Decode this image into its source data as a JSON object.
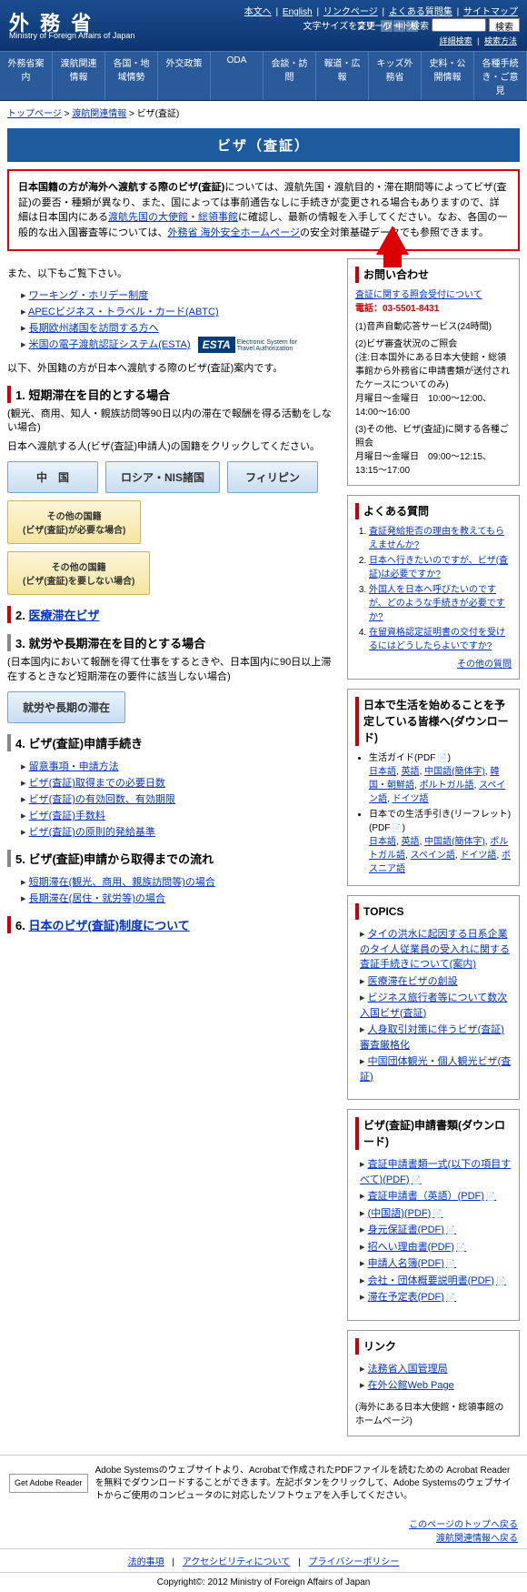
{
  "header": {
    "logo": "外 務 省",
    "logo_sub": "Ministry of Foreign Affairs of Japan",
    "top_links": [
      "本文へ",
      "English",
      "リンクページ",
      "よくある質問集",
      "サイトマップ"
    ],
    "font_label": "文字サイズを変更",
    "font_btns": [
      "小",
      "中",
      "大"
    ],
    "search_label": "フリーワード検索",
    "search_btn": "検索",
    "search_sub": [
      "詳細検索",
      "検索方法"
    ]
  },
  "nav": [
    "外務省案内",
    "渡航関連情報",
    "各国・地域情勢",
    "外交政策",
    "ODA",
    "会談・訪問",
    "報道・広報",
    "キッズ外務省",
    "史料・公開情報",
    "各種手続き・ご意見"
  ],
  "breadcrumb": {
    "items": [
      "トップページ",
      "渡航関連情報"
    ],
    "current": "ビザ(査証)"
  },
  "title": "ビザ（査証）",
  "notice": {
    "bold": "日本国籍の方が海外へ渡航する際のビザ(査証)",
    "text1": "については、渡航先国・渡航目的・滞在期間等によってビザ(査証)の要否・種類が異なり、また、国によっては事前通告なしに手続きが変更される場合もありますので、詳細は日本国内にある",
    "link1": "渡航先国の大使館・総領事館",
    "text2": "に確認し、最新の情報を入手してください。なお、各国の一般的な出入国審査等については、",
    "link2": "外務省 海外安全ホームページ",
    "text3": "の安全対策基礎データでも参照できます。"
  },
  "intro": "また、以下もご覧下さい。",
  "intro_links": [
    "ワーキング・ホリデー制度",
    "APECビジネス・トラベル・カード(ABTC)",
    "長期欧州諸国を訪問する方へ",
    "米国の電子渡航認証システム(ESTA)"
  ],
  "section_intro": "以下、外国籍の方が日本へ渡航する際のビザ(査証)案内です。",
  "sec1": {
    "h": "1. 短期滞在を目的とする場合",
    "sub": "(観光、商用、知人・親族訪問等90日以内の滞在で報酬を得る活動をしない場合)",
    "sub2": "日本へ渡航する人(ビザ(査証)申請人)の国籍をクリックしてください。",
    "btns": [
      "中　国",
      "ロシア・NIS諸国",
      "フィリピン"
    ],
    "yellow": [
      "その他の国籍\n(ビザ(査証)が必要な場合)",
      "その他の国籍\n(ビザ(査証)を要しない場合)"
    ]
  },
  "sec2": {
    "h": "2.",
    "link": "医療滞在ビザ"
  },
  "sec3": {
    "h": "3. 就労や長期滞在を目的とする場合",
    "sub": "(日本国内において報酬を得て仕事をするときや、日本国内に90日以上滞在するときなど短期滞在の要件に該当しない場合)",
    "btn": "就労や長期の滞在"
  },
  "sec4": {
    "h": "4. ビザ(査証)申請手続き",
    "links": [
      "留意事項・申請方法",
      "ビザ(査証)取得までの必要日数",
      "ビザ(査証)の有効回数、有効期限",
      "ビザ(査証)手数料",
      "ビザ(査証)の原則的発給基準"
    ]
  },
  "sec5": {
    "h": "5. ビザ(査証)申請から取得までの流れ",
    "links": [
      "短期滞在(観光、商用、親族訪問等)の場合",
      "長期滞在(居住・就労等)の場合"
    ]
  },
  "sec6": {
    "h": "6.",
    "link": "日本のビザ(査証)制度について"
  },
  "side": {
    "inquiry": {
      "h": "お問い合わせ",
      "link": "査証に関する照会受付について",
      "tel_label": "電話：",
      "tel": "03-5501-8431",
      "items": [
        "(1)音声自動応答サービス(24時間)",
        "(2)ビザ審査状況のご照会\n(注:日本国外にある日本大使館・総領事館から外務省に申請書類が送付されたケースについてのみ)\n月曜日～金曜日　10:00～12:00、14:00～16:00",
        "(3)その他、ビザ(査証)に関する各種ご照会\n月曜日～金曜日　09:00～12:15、13:15～17:00"
      ]
    },
    "faq": {
      "h": "よくある質問",
      "items": [
        "査証発給拒否の理由を教えてもらえませんか?",
        "日本へ行きたいのですが、ビザ(査証)は必要ですか?",
        "外国人を日本へ呼びたいのですが、どのような手続きが必要ですか?",
        "在留資格認定証明書の交付を受けるにはどうしたらよいですか?"
      ],
      "more": "その他の質問"
    },
    "dl": {
      "h": "日本で生活を始めることを予定している皆様へ(ダウンロード)",
      "g1": "生活ガイド(PDF",
      "g1_links": [
        "日本語",
        "英語",
        "中国語(簡体字)",
        "韓国・朝鮮語",
        "ポルトガル語",
        "スペイン語",
        "ドイツ語"
      ],
      "g2": "日本での生活手引き(リーフレット)(PDF",
      "g2_links": [
        "日本語",
        "英語",
        "中国語(簡体字)",
        "ポルトガル語",
        "スペイン語",
        "ドイツ語",
        "ボスニア語"
      ]
    },
    "topics": {
      "h": "TOPICS",
      "items": [
        "タイの洪水に起因する日系企業のタイ人従業員の受入れに関する査証手続きについて(案内)",
        "医療滞在ビザの創設",
        "ビジネス旅行者等について数次入国ビザ(査証)",
        "人身取引対策に伴うビザ(査証)審査厳格化",
        "中国団体観光・個人観光ビザ(査証)"
      ]
    },
    "docs": {
      "h": "ビザ(査証)申請書類(ダウンロード)",
      "items": [
        "査証申請書類一式(以下の項目すべて)(PDF)",
        "査証申請書（英語）(PDF)",
        "(中国語)(PDF)",
        "身元保証書(PDF)",
        "招へい理由書(PDF)",
        "申請人名簿(PDF)",
        "会社・団体概要説明書(PDF)",
        "滞在予定表(PDF)"
      ]
    },
    "links": {
      "h": "リンク",
      "items": [
        "法務省入国管理局",
        "在外公館Web Page"
      ],
      "note": "(海外にある日本大使館・総領事館のホームページ)"
    }
  },
  "adobe": {
    "badge": "Get Adobe Reader",
    "text": "Adobe Systemsのウェブサイトより、Acrobatで作成されたPDFファイルを読むための Acrobat Readerを無料でダウンロードすることができます。左記ボタンをクリックして、Adobe Systemsのウェブサイトからご使用のコンピュータのに対応したソフトウェアを入手してください。"
  },
  "footer": {
    "top_link": "このページのトップへ戻る",
    "back_link": "渡航関連情報へ戻る",
    "nav": [
      "法的事項",
      "アクセシビリティについて",
      "プライバシーポリシー"
    ],
    "copy": "Copyright©: 2012 Ministry of Foreign Affairs of Japan"
  }
}
